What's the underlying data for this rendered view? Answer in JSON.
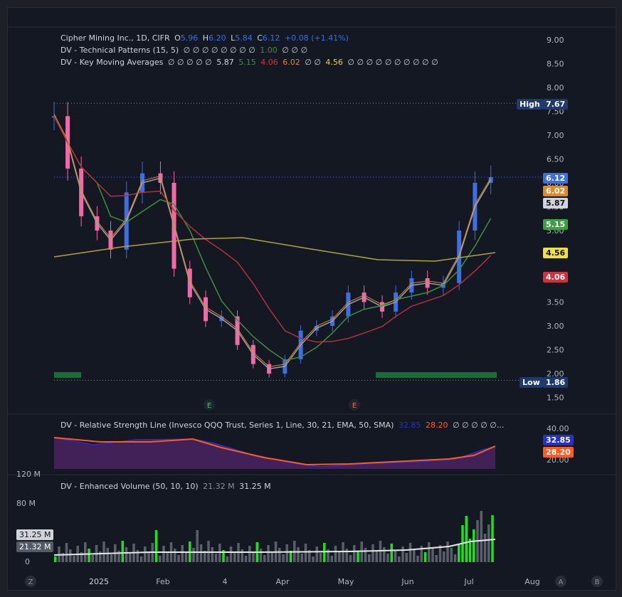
{
  "legend": {
    "symbol_line": {
      "name": "Cipher Mining Inc., 1D, CIFR",
      "o_label": "O",
      "o": "5.96",
      "h_label": "H",
      "h": "6.20",
      "l_label": "L",
      "l": "5.84",
      "c_label": "C",
      "c": "6.12",
      "change": "+0.08 (+1.41%)"
    },
    "patterns_line": {
      "name": "DV - Technical Patterns (15, 5)",
      "values": "∅ ∅ ∅ ∅ ∅ ∅ ∅ ∅",
      "value_green": "1.00",
      "values_tail": "∅ ∅ ∅"
    },
    "ma_line": {
      "name": "DV - Key Moving Averages",
      "values_head": "∅ ∅ ∅ ∅ ∅",
      "v1": "5.87",
      "v2": "5.15",
      "v3": "4.06",
      "v4": "6.02",
      "values_mid": "∅ ∅",
      "v5": "4.56",
      "values_tail": "∅ ∅ ∅ ∅ ∅ ∅ ∅ ∅ ∅ ∅"
    },
    "rs_line": {
      "name": "DV - Relative Strength Line (Invesco QQQ Trust, Series 1, Line, 30, 21, EMA, 50, SMA)",
      "v1": "32.85",
      "v2": "28.20",
      "values_tail": "∅ ∅ ∅ ∅ ∅..."
    },
    "vol_line": {
      "name": "DV - Enhanced Volume (50, 10, 10)",
      "v1": "21.32 M",
      "v2": "31.25 M"
    }
  },
  "price_axis": [
    "9.00",
    "8.50",
    "8.00",
    "7.50",
    "7.00",
    "6.50",
    "6.00",
    "5.50",
    "5.00",
    "4.50",
    "4.00",
    "3.50",
    "3.00",
    "2.50",
    "2.00",
    "1.50"
  ],
  "rs_axis": [
    "40.00",
    "20.00"
  ],
  "vol_axis": [
    "120 M",
    "80 M",
    "0"
  ],
  "time_axis": [
    "2025",
    "Feb",
    "4",
    "Apr",
    "May",
    "Jun",
    "Jul",
    "Aug"
  ],
  "badges": {
    "high_label": "High",
    "high": "7.67",
    "low_label": "Low",
    "low": "1.86",
    "price": "6.12",
    "ma_orange": "6.02",
    "ma_gray": "5.87",
    "ma_green": "5.15",
    "ma_yellow": "4.56",
    "ma_red": "4.06",
    "rs_blue": "32.85",
    "rs_orange": "28.20",
    "vol_ma": "31.25 M",
    "vol_cur": "21.32 M"
  },
  "earnings_markers": [
    "E",
    "E"
  ],
  "corner_buttons": [
    "Z",
    "A",
    "B"
  ],
  "colors": {
    "up": "#3d6fe0",
    "down": "#f06aa8",
    "ma_gray": "#9aa0a6",
    "ma_green": "#3e8e41",
    "ma_red": "#b3303a",
    "ma_yellow": "#b5a23a",
    "ma_orange": "#e0882a",
    "rs_blue": "#2531c8",
    "rs_orange": "#ff5a1f"
  },
  "chart_data": {
    "type": "candlestick",
    "title": "Cipher Mining Inc., 1D, CIFR",
    "ohlc_last": {
      "open": 5.96,
      "high": 6.2,
      "low": 5.84,
      "close": 6.12
    },
    "y_range": [
      1.5,
      9.0
    ],
    "period_high": 7.67,
    "period_low": 1.86,
    "close_series": [
      {
        "date": "2025-01-02",
        "close": 7.4
      },
      {
        "date": "2025-01-08",
        "close": 6.3
      },
      {
        "date": "2025-01-14",
        "close": 5.3
      },
      {
        "date": "2025-01-21",
        "close": 5.0
      },
      {
        "date": "2025-01-27",
        "close": 4.6
      },
      {
        "date": "2025-02-03",
        "close": 5.8
      },
      {
        "date": "2025-02-10",
        "close": 6.2
      },
      {
        "date": "2025-02-18",
        "close": 6.0
      },
      {
        "date": "2025-02-24",
        "close": 4.2
      },
      {
        "date": "2025-03-03",
        "close": 3.6
      },
      {
        "date": "2025-03-10",
        "close": 3.1
      },
      {
        "date": "2025-03-17",
        "close": 3.2
      },
      {
        "date": "2025-03-24",
        "close": 2.6
      },
      {
        "date": "2025-03-31",
        "close": 2.2
      },
      {
        "date": "2025-04-07",
        "close": 2.0
      },
      {
        "date": "2025-04-14",
        "close": 2.3
      },
      {
        "date": "2025-04-21",
        "close": 2.9
      },
      {
        "date": "2025-04-28",
        "close": 3.0
      },
      {
        "date": "2025-05-05",
        "close": 3.2
      },
      {
        "date": "2025-05-12",
        "close": 3.7
      },
      {
        "date": "2025-05-19",
        "close": 3.5
      },
      {
        "date": "2025-05-27",
        "close": 3.3
      },
      {
        "date": "2025-06-02",
        "close": 3.7
      },
      {
        "date": "2025-06-09",
        "close": 4.0
      },
      {
        "date": "2025-06-16",
        "close": 3.8
      },
      {
        "date": "2025-06-23",
        "close": 3.9
      },
      {
        "date": "2025-06-30",
        "close": 5.0
      },
      {
        "date": "2025-07-07",
        "close": 6.0
      },
      {
        "date": "2025-07-14",
        "close": 6.12
      }
    ],
    "moving_averages": [
      {
        "name": "MA gray",
        "last": 5.87
      },
      {
        "name": "MA green",
        "last": 5.15
      },
      {
        "name": "MA red",
        "last": 4.06
      },
      {
        "name": "MA orange",
        "last": 6.02
      },
      {
        "name": "MA yellow",
        "last": 4.56
      }
    ],
    "relative_strength": {
      "line_last": 32.85,
      "ma_last": 28.2,
      "y_range": [
        20,
        40
      ]
    },
    "volume": {
      "last": 21.32,
      "ma_last": 31.25,
      "unit": "M",
      "y_range": [
        0,
        120
      ]
    },
    "x_ticks": [
      "2025",
      "Feb",
      "4",
      "Apr",
      "May",
      "Jun",
      "Jul",
      "Aug"
    ]
  }
}
